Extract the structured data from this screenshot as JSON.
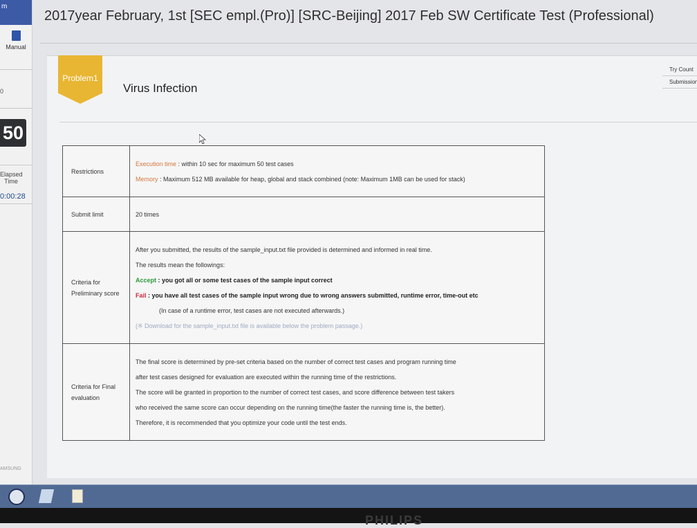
{
  "sidebar": {
    "top_text": "m",
    "manual_label": "Manual",
    "small_a": "0",
    "score": "50",
    "elapsed_label": "Elapsed Time",
    "timer": "0:00:28",
    "brand": "AMSUNG"
  },
  "header": {
    "title": "2017year February, 1st [SEC empl.(Pro)] [SRC-Beijing] 2017 Feb SW Certificate Test (Professional)"
  },
  "problem": {
    "badge": "Problem1",
    "title": "Virus Infection"
  },
  "side_buttons": [
    "Try Count",
    "Submission"
  ],
  "rules": {
    "restrictions": {
      "label": "Restrictions",
      "exec_key": "Execution time",
      "exec_val": " : within 10 sec for maximum  50 test cases",
      "mem_key": "Memory",
      "mem_val": " : Maximum  512  MB available for heap, global and stack combined (note: Maximum  1MB can be used for stack)"
    },
    "submit": {
      "label": "Submit limit",
      "value": "20 times"
    },
    "preliminary": {
      "label": "Criteria for Preliminary score",
      "line1": "After you submitted, the results of the sample_input.txt file provided is determined and informed in real time.",
      "line2": "The results mean the followings:",
      "accept_key": "Accept",
      "accept_val": " : you got all or some test cases of the sample input correct",
      "fail_key": "Fail",
      "fail_val": " : you have all test cases of the sample input wrong due to wrong answers submitted, runtime error, time-out etc",
      "note": "(In case of a runtime error, test cases are not executed afterwards.)",
      "download": "(※ Download for the sample_input.txt file is available below the problem passage.)"
    },
    "final": {
      "label": "Criteria for Final evaluation",
      "line1": "The final score is determined by pre-set criteria based on the number of correct test cases and program running time",
      "line2": "after test cases designed for evaluation are executed within the running time of the restrictions.",
      "line3": "The score will be granted in proportion to the number of correct test cases, and score difference between test takers",
      "line4": "who received the same score can occur depending on the running time(the faster the running time is, the better).",
      "line5": "Therefore, it is recommended  that you optimize your code until the test ends."
    }
  },
  "bezel_brand": "PHILIPS"
}
